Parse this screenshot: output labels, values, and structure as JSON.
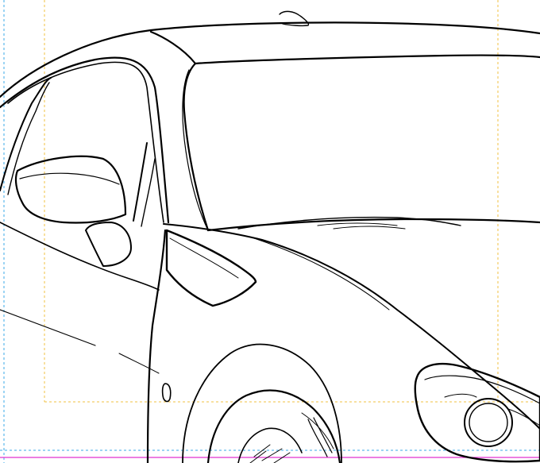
{
  "canvas": {
    "background": "#ffffff",
    "subject": "car-line-art"
  },
  "guides": {
    "outer_color": "#38a8e8",
    "safe_color": "#f0c040",
    "bleed_color": "#e030d0"
  },
  "art": {
    "stroke_color": "#000000",
    "fill_color": "#ffffff"
  }
}
